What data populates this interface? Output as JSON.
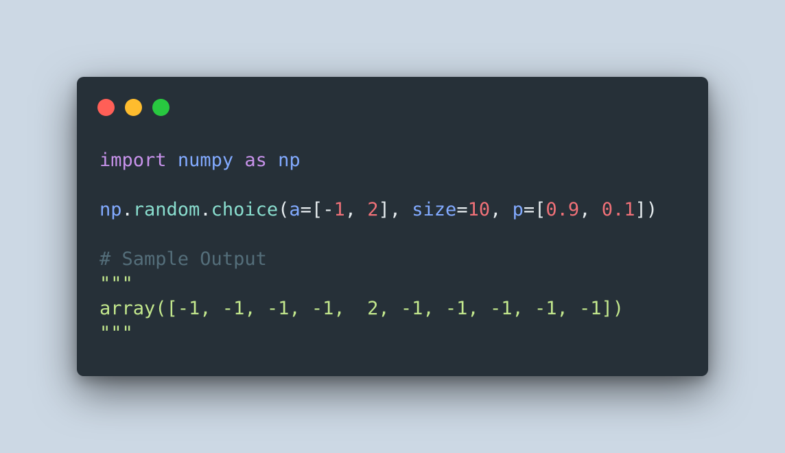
{
  "window": {
    "controls": [
      {
        "name": "close",
        "color": "#ff5f57"
      },
      {
        "name": "minimize",
        "color": "#febc2e"
      },
      {
        "name": "maximize",
        "color": "#28c840"
      }
    ]
  },
  "code": {
    "line1": {
      "kw_import": "import",
      "module": "numpy",
      "kw_as": "as",
      "alias": "np"
    },
    "line2": {
      "obj": "np",
      "dot1": ".",
      "attr": "random",
      "dot2": ".",
      "func": "choice",
      "paren_open": "(",
      "arg_a": "a",
      "eq1": "=",
      "bracket1_open": "[-",
      "num_neg1": "1",
      "comma1": ", ",
      "num_2": "2",
      "bracket1_close": "], ",
      "arg_size": "size",
      "eq2": "=",
      "num_10": "10",
      "comma2": ", ",
      "arg_p": "p",
      "eq3": "=",
      "bracket2_open": "[",
      "num_09": "0.9",
      "comma3": ", ",
      "num_01": "0.1",
      "close": "])"
    },
    "comment": "# Sample Output",
    "docstring_open": "\"\"\"",
    "output": "array([-1, -1, -1, -1,  2, -1, -1, -1, -1, -1])",
    "docstring_close": "\"\"\""
  },
  "colors": {
    "background": "#ccd8e4",
    "window": "#263038",
    "keyword": "#c792ea",
    "identifier": "#82aaff",
    "method": "#89ddce",
    "number": "#f07178",
    "punctuation": "#e6ecef",
    "comment": "#546e7a",
    "string": "#c3e88d"
  }
}
